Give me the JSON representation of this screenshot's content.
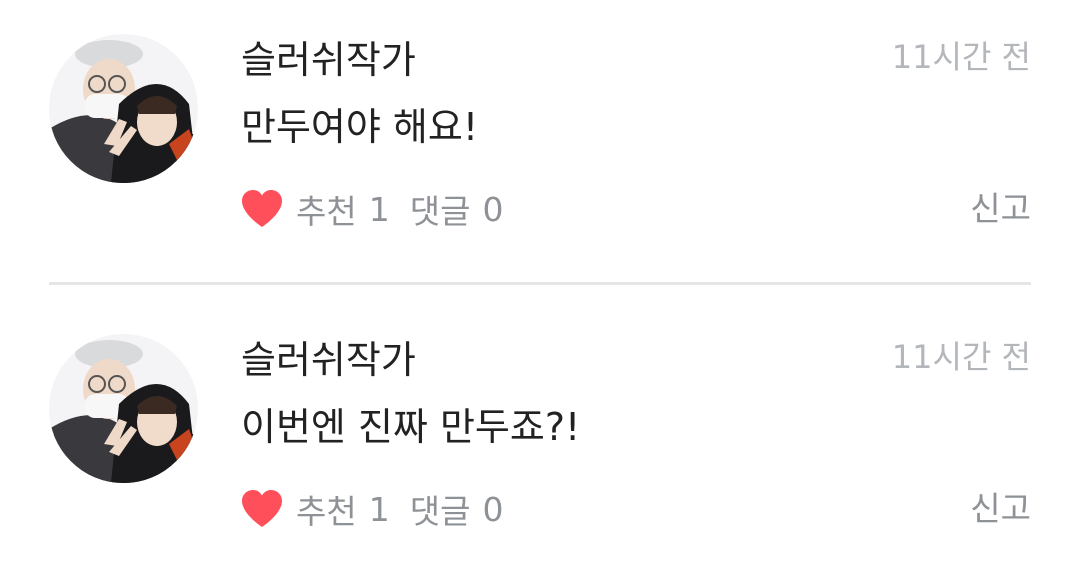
{
  "comments": [
    {
      "author": "슬러쉬작가",
      "time": "11시간 전",
      "text": "만두여야 해요!",
      "like_label": "추천",
      "like_count": "1",
      "reply_label": "댓글",
      "reply_count": "0",
      "report_label": "신고"
    },
    {
      "author": "슬러쉬작가",
      "time": "11시간 전",
      "text": "이번엔 진짜 만두죠?!",
      "like_label": "추천",
      "like_count": "1",
      "reply_label": "댓글",
      "reply_count": "0",
      "report_label": "신고"
    }
  ],
  "icons": {
    "like": "heart-icon"
  },
  "colors": {
    "heart": "#ff4f5a",
    "text_primary": "#222222",
    "text_secondary": "#8e9296",
    "timestamp": "#b3b6ba",
    "divider": "#e5e6e8"
  }
}
